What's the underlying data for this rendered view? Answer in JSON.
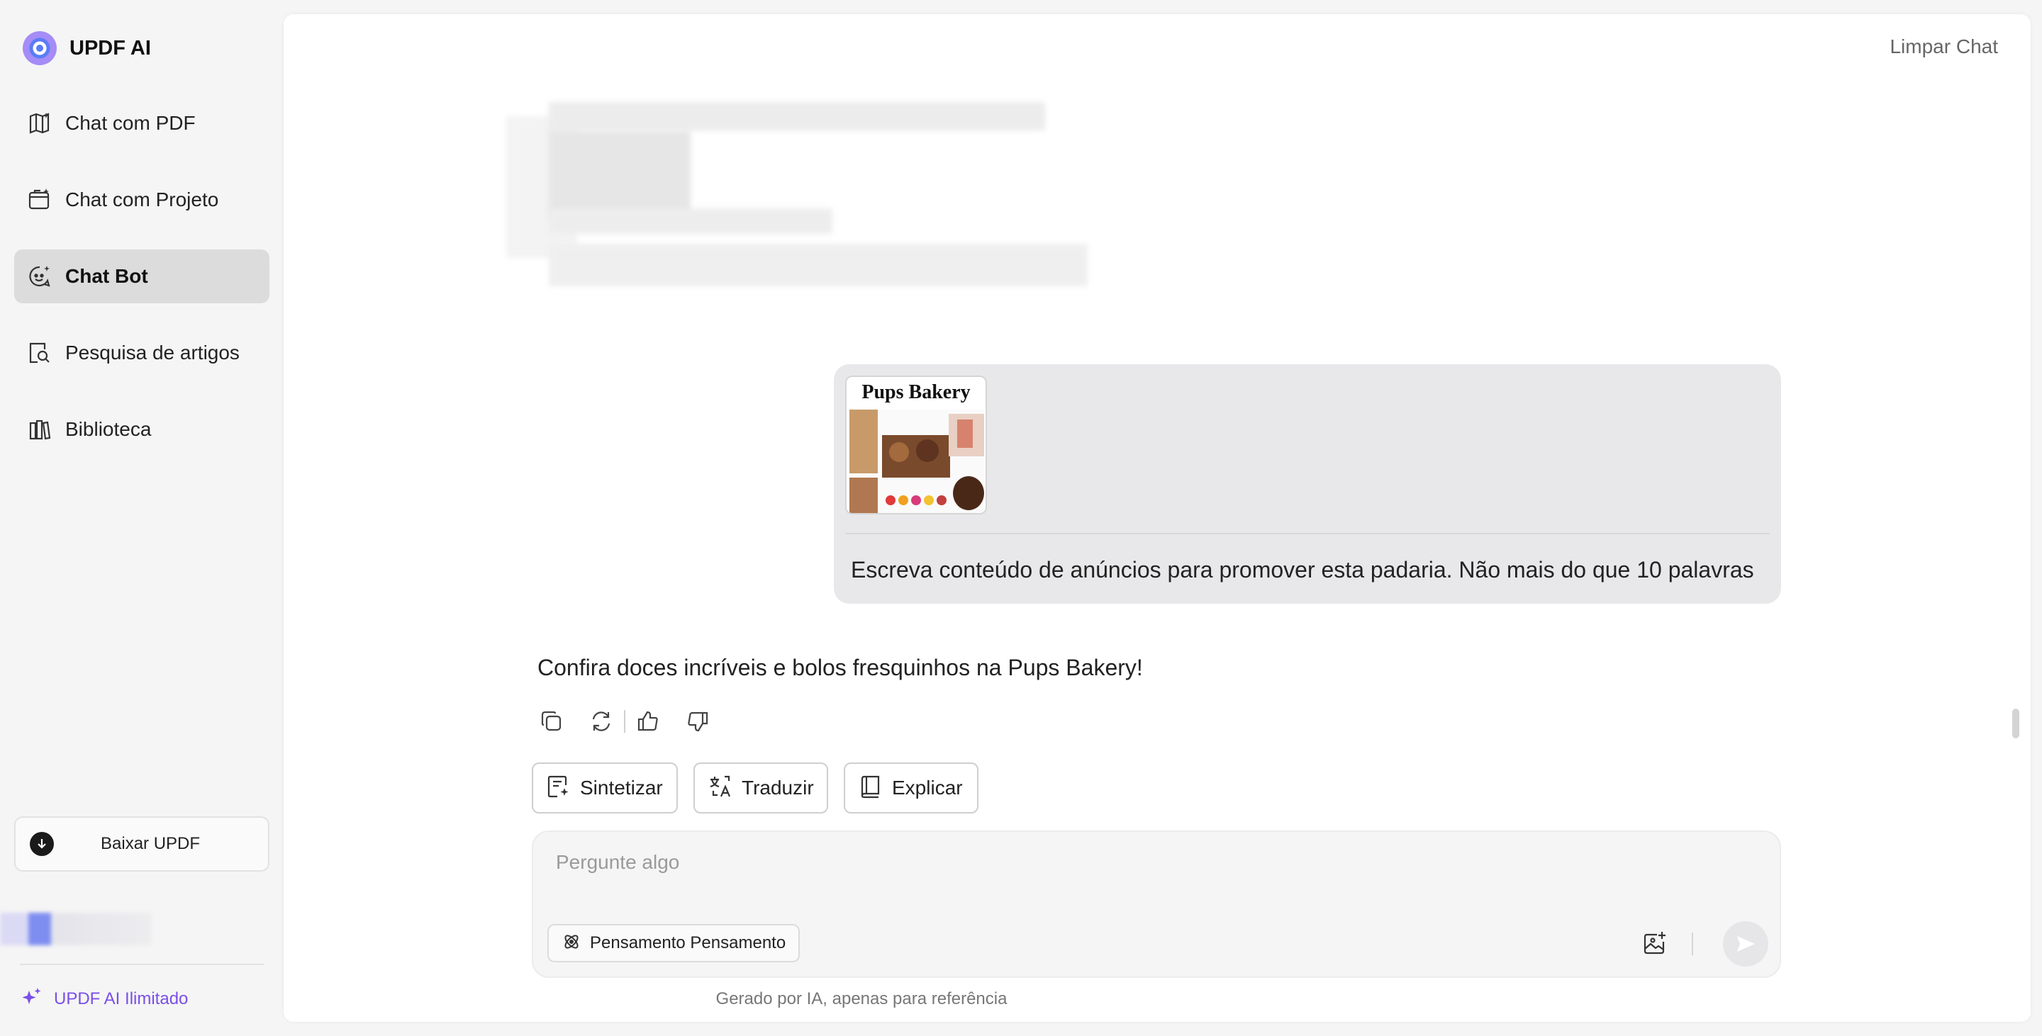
{
  "brand": {
    "name": "UPDF AI"
  },
  "sidebar": {
    "items": [
      {
        "label": "Chat com PDF",
        "icon": "pdf-chat-icon"
      },
      {
        "label": "Chat com Projeto",
        "icon": "project-chat-icon"
      },
      {
        "label": "Chat Bot",
        "icon": "chat-bot-icon",
        "active": true
      },
      {
        "label": "Pesquisa de artigos",
        "icon": "article-search-icon"
      },
      {
        "label": "Biblioteca",
        "icon": "library-icon"
      }
    ],
    "download_label": "Baixar UPDF",
    "unlimited_label": "UPDF AI Ilimitado"
  },
  "header": {
    "clear_chat": "Limpar Chat"
  },
  "conversation": {
    "user_message": {
      "attachment_title": "Pups Bakery",
      "text": "Escreva conteúdo de anúncios para promover esta padaria. Não mais do que 10 palavras"
    },
    "ai_reply": "Confira doces incríveis e bolos fresquinhos na Pups Bakery!"
  },
  "quick_actions": [
    {
      "label": "Sintetizar",
      "icon": "summarize-icon"
    },
    {
      "label": "Traduzir",
      "icon": "translate-icon"
    },
    {
      "label": "Explicar",
      "icon": "book-icon"
    }
  ],
  "composer": {
    "placeholder": "Pergunte algo",
    "thinking_label": "Pensamento Pensamento"
  },
  "footer": {
    "note": "Gerado por IA, apenas para referência"
  },
  "colors": {
    "accent": "#7a4fe8",
    "active_bg": "#dcdcdc",
    "bubble_bg": "#e8e8ea"
  }
}
